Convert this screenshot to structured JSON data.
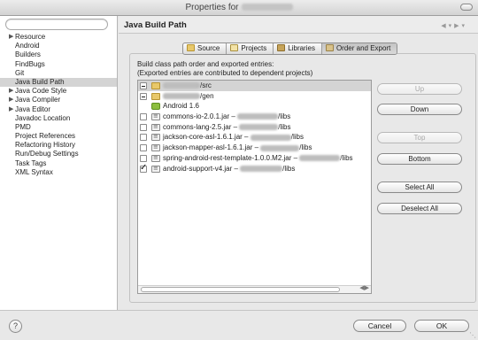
{
  "window": {
    "title_prefix": "Properties for"
  },
  "sidebar": {
    "items": [
      {
        "label": "Resource",
        "expandable": true
      },
      {
        "label": "Android",
        "expandable": false
      },
      {
        "label": "Builders",
        "expandable": false
      },
      {
        "label": "FindBugs",
        "expandable": false
      },
      {
        "label": "Git",
        "expandable": false
      },
      {
        "label": "Java Build Path",
        "expandable": false,
        "selected": true
      },
      {
        "label": "Java Code Style",
        "expandable": true
      },
      {
        "label": "Java Compiler",
        "expandable": true
      },
      {
        "label": "Java Editor",
        "expandable": true
      },
      {
        "label": "Javadoc Location",
        "expandable": false
      },
      {
        "label": "PMD",
        "expandable": false
      },
      {
        "label": "Project References",
        "expandable": false
      },
      {
        "label": "Refactoring History",
        "expandable": false
      },
      {
        "label": "Run/Debug Settings",
        "expandable": false
      },
      {
        "label": "Task Tags",
        "expandable": false
      },
      {
        "label": "XML Syntax",
        "expandable": false
      }
    ]
  },
  "main": {
    "title": "Java Build Path",
    "tabs": [
      {
        "label": "Source",
        "icon": "source-folder-icon"
      },
      {
        "label": "Projects",
        "icon": "projects-icon"
      },
      {
        "label": "Libraries",
        "icon": "libraries-icon"
      },
      {
        "label": "Order and Export",
        "icon": "order-export-icon",
        "active": true
      }
    ],
    "description_line1": "Build class path order and exported entries:",
    "description_line2": "(Exported entries are contributed to dependent projects)",
    "entries": [
      {
        "prefix": "",
        "suffix": "/src",
        "icon": "folder-icon",
        "check": "partial",
        "selected": true
      },
      {
        "prefix": "",
        "suffix": "/gen",
        "icon": "folder-icon",
        "check": "partial"
      },
      {
        "prefix": "Android 1.6",
        "suffix": "",
        "icon": "android-icon",
        "check": "none"
      },
      {
        "prefix": "commons-io-2.0.1.jar – ",
        "suffix": "/libs",
        "icon": "jar-icon",
        "check": "off"
      },
      {
        "prefix": "commons-lang-2.5.jar – ",
        "suffix": "/libs",
        "icon": "jar-icon",
        "check": "off"
      },
      {
        "prefix": "jackson-core-asl-1.6.1.jar – ",
        "suffix": "/libs",
        "icon": "jar-icon",
        "check": "off"
      },
      {
        "prefix": "jackson-mapper-asl-1.6.1.jar – ",
        "suffix": "/libs",
        "icon": "jar-icon",
        "check": "off"
      },
      {
        "prefix": "spring-android-rest-template-1.0.0.M2.jar – ",
        "suffix": "/libs",
        "icon": "jar-icon",
        "check": "off"
      },
      {
        "prefix": "android-support-v4.jar – ",
        "suffix": "/libs",
        "icon": "jar-icon",
        "check": "on"
      }
    ],
    "buttons": {
      "up": "Up",
      "down": "Down",
      "top": "Top",
      "bottom": "Bottom",
      "select_all": "Select All",
      "deselect_all": "Deselect All"
    }
  },
  "footer": {
    "help": "?",
    "cancel": "Cancel",
    "ok": "OK"
  }
}
